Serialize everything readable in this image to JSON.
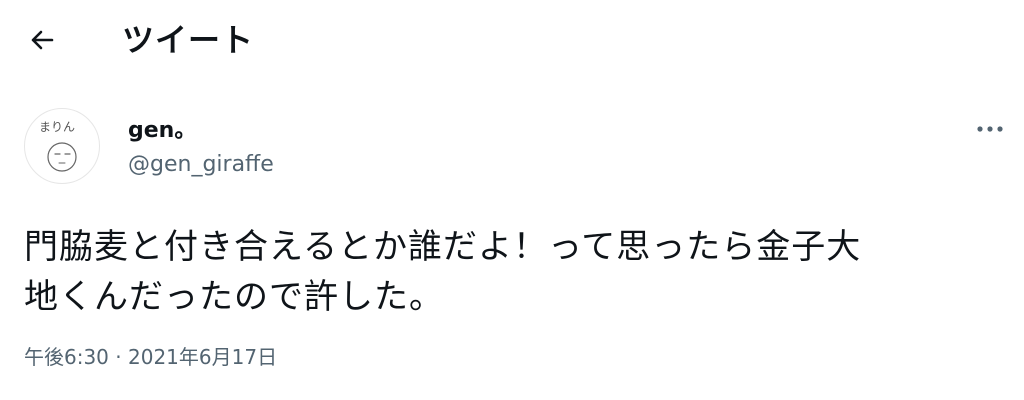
{
  "header": {
    "title": "ツイート",
    "back_icon": "arrow-left-icon"
  },
  "tweet": {
    "avatar_icon": "avatar-sketch",
    "avatar_caption": "まりん",
    "display_name": "gen。",
    "handle": "@gen_giraffe",
    "more_icon": "more-horizontal-icon",
    "text_line1": "門脇麦と付き合えるとか誰だよ！って思ったら金子大",
    "text_line2": "地くんだったので許した。",
    "time": "午後6:30",
    "separator": "·",
    "date": "2021年6月17日"
  }
}
